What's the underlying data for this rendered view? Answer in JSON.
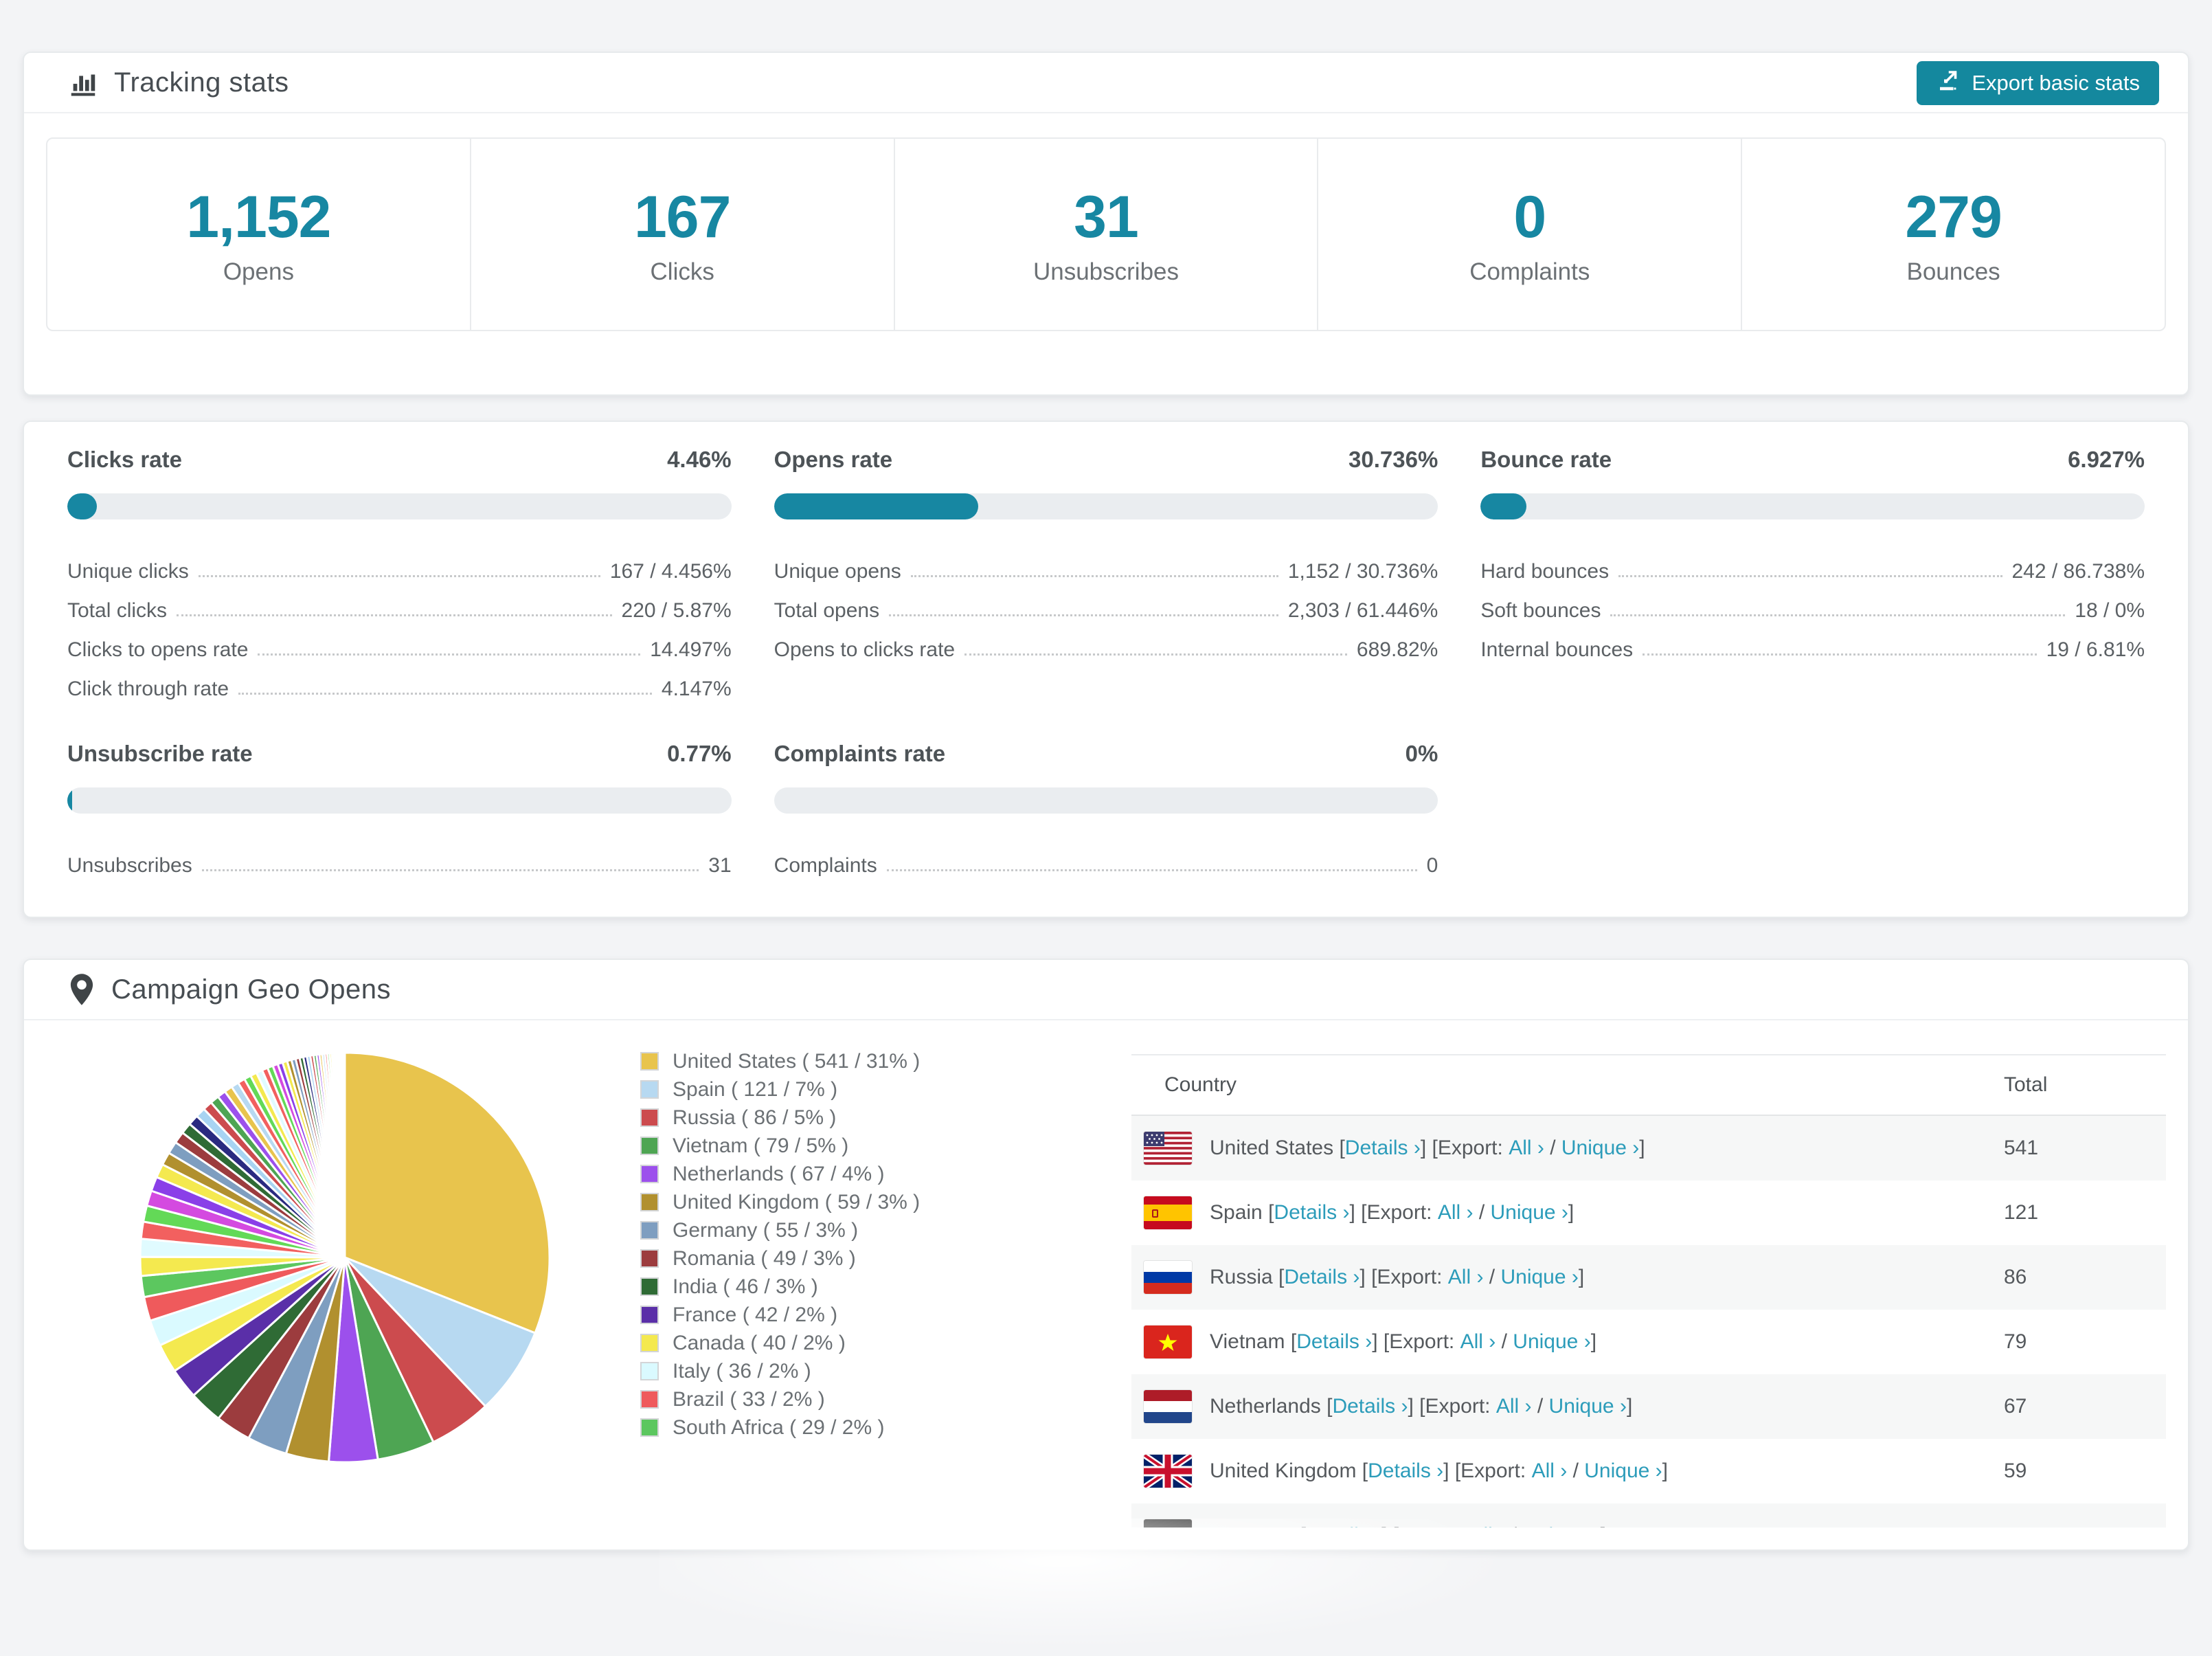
{
  "accent_color": "#1787a2",
  "link_color": "#2c9cba",
  "tracking": {
    "title": "Tracking stats",
    "export_label": "Export basic stats",
    "stats": [
      {
        "value": "1,152",
        "label": "Opens"
      },
      {
        "value": "167",
        "label": "Clicks"
      },
      {
        "value": "31",
        "label": "Unsubscribes"
      },
      {
        "value": "0",
        "label": "Complaints"
      },
      {
        "value": "279",
        "label": "Bounces"
      }
    ]
  },
  "rates": [
    {
      "title": "Clicks rate",
      "value": "4.46%",
      "percent": 4.46,
      "rows": [
        {
          "label": "Unique clicks",
          "value": "167 / 4.456%"
        },
        {
          "label": "Total clicks",
          "value": "220 / 5.87%"
        },
        {
          "label": "Clicks to opens rate",
          "value": "14.497%"
        },
        {
          "label": "Click through rate",
          "value": "4.147%"
        }
      ]
    },
    {
      "title": "Opens rate",
      "value": "30.736%",
      "percent": 30.736,
      "rows": [
        {
          "label": "Unique opens",
          "value": "1,152 / 30.736%"
        },
        {
          "label": "Total opens",
          "value": "2,303 / 61.446%"
        },
        {
          "label": "Opens to clicks rate",
          "value": "689.82%"
        }
      ]
    },
    {
      "title": "Bounce rate",
      "value": "6.927%",
      "percent": 6.927,
      "rows": [
        {
          "label": "Hard bounces",
          "value": "242 / 86.738%"
        },
        {
          "label": "Soft bounces",
          "value": "18 / 0%"
        },
        {
          "label": "Internal bounces",
          "value": "19 / 6.81%"
        }
      ]
    },
    {
      "title": "Unsubscribe rate",
      "value": "0.77%",
      "percent": 0.77,
      "rows": [
        {
          "label": "Unsubscribes",
          "value": "31"
        }
      ]
    },
    {
      "title": "Complaints rate",
      "value": "0%",
      "percent": 0,
      "rows": [
        {
          "label": "Complaints",
          "value": "0"
        }
      ]
    }
  ],
  "geo": {
    "title": "Campaign Geo Opens",
    "table": {
      "headers": {
        "country": "Country",
        "total": "Total"
      },
      "link_labels": {
        "details": "Details ›",
        "export": "Export:",
        "all": "All ›",
        "unique": "Unique ›"
      },
      "rows": [
        {
          "country": "United States",
          "flag": "us",
          "total": "541"
        },
        {
          "country": "Spain",
          "flag": "es",
          "total": "121"
        },
        {
          "country": "Russia",
          "flag": "ru",
          "total": "86"
        },
        {
          "country": "Vietnam",
          "flag": "vn",
          "total": "79"
        },
        {
          "country": "Netherlands",
          "flag": "nl",
          "total": "67"
        },
        {
          "country": "United Kingdom",
          "flag": "gb",
          "total": "59"
        },
        {
          "country": "Germany",
          "flag": "de",
          "total": ""
        }
      ]
    },
    "chart_data": {
      "type": "pie",
      "title": "Campaign Geo Opens",
      "legend_position": "right",
      "start_angle_deg": 0,
      "direction": "clockwise",
      "slices": [
        {
          "label": "United States ( 541 / 31% )",
          "name": "United States",
          "value": 541,
          "pct": 31,
          "color": "#e8c44d"
        },
        {
          "label": "Spain ( 121 / 7% )",
          "name": "Spain",
          "value": 121,
          "pct": 7,
          "color": "#b7d9f1"
        },
        {
          "label": "Russia ( 86 / 5% )",
          "name": "Russia",
          "value": 86,
          "pct": 5,
          "color": "#cc4b4e"
        },
        {
          "label": "Vietnam ( 79 / 5% )",
          "name": "Vietnam",
          "value": 79,
          "pct": 5,
          "color": "#4ea553"
        },
        {
          "label": "Netherlands ( 67 / 4% )",
          "name": "Netherlands",
          "value": 67,
          "pct": 4,
          "color": "#9c50ec"
        },
        {
          "label": "United Kingdom ( 59 / 3% )",
          "name": "United Kingdom",
          "value": 59,
          "pct": 3,
          "color": "#b1902f"
        },
        {
          "label": "Germany ( 55 / 3% )",
          "name": "Germany",
          "value": 55,
          "pct": 3,
          "color": "#7e9ec0"
        },
        {
          "label": "Romania ( 49 / 3% )",
          "name": "Romania",
          "value": 49,
          "pct": 3,
          "color": "#9c3c3e"
        },
        {
          "label": "India ( 46 / 3% )",
          "name": "India",
          "value": 46,
          "pct": 3,
          "color": "#2f6b35"
        },
        {
          "label": "France ( 42 / 2% )",
          "name": "France",
          "value": 42,
          "pct": 2,
          "color": "#5a2fa8"
        },
        {
          "label": "Canada ( 40 / 2% )",
          "name": "Canada",
          "value": 40,
          "pct": 2,
          "color": "#f4e94f"
        },
        {
          "label": "Italy ( 36 / 2% )",
          "name": "Italy",
          "value": 36,
          "pct": 2,
          "color": "#dafaff"
        },
        {
          "label": "Brazil ( 33 / 2% )",
          "name": "Brazil",
          "value": 33,
          "pct": 2,
          "color": "#ef5a5c"
        },
        {
          "label": "South Africa ( 29 / 2% )",
          "name": "South Africa",
          "value": 29,
          "pct": 2,
          "color": "#5cc75f"
        }
      ],
      "others_values": [
        26,
        24.6,
        23.4,
        22.2,
        21,
        19.9,
        18.9,
        17.9,
        17,
        16.1,
        15.2,
        14.5,
        13.7,
        13,
        12.3,
        11.7,
        11.1,
        10.5,
        9.9,
        9.4,
        8.9,
        8.5,
        8,
        7.6,
        7.2,
        6.8,
        6.5,
        6.1,
        5.8,
        5.5,
        5.2,
        4.9,
        4.7,
        4.4,
        4.2,
        4,
        3.8,
        3.6,
        3.4,
        3.2,
        3.1,
        2.9,
        2.8,
        2.6,
        2.5,
        2.4,
        2.2,
        2.1
      ],
      "fan_colors": [
        "#f4e94f",
        "#e0fbff",
        "#f2605f",
        "#63d957",
        "#d44ae0",
        "#8a3fe8",
        "#f4e94f",
        "#b1902f",
        "#7e9ec0",
        "#9c3c3e",
        "#2f6b35",
        "#2a2a80",
        "#a8d4f2",
        "#cc4b4e",
        "#4ea553",
        "#9c50ec",
        "#e8c44d",
        "#b7d9f1",
        "#f2605f",
        "#63d957"
      ]
    }
  }
}
